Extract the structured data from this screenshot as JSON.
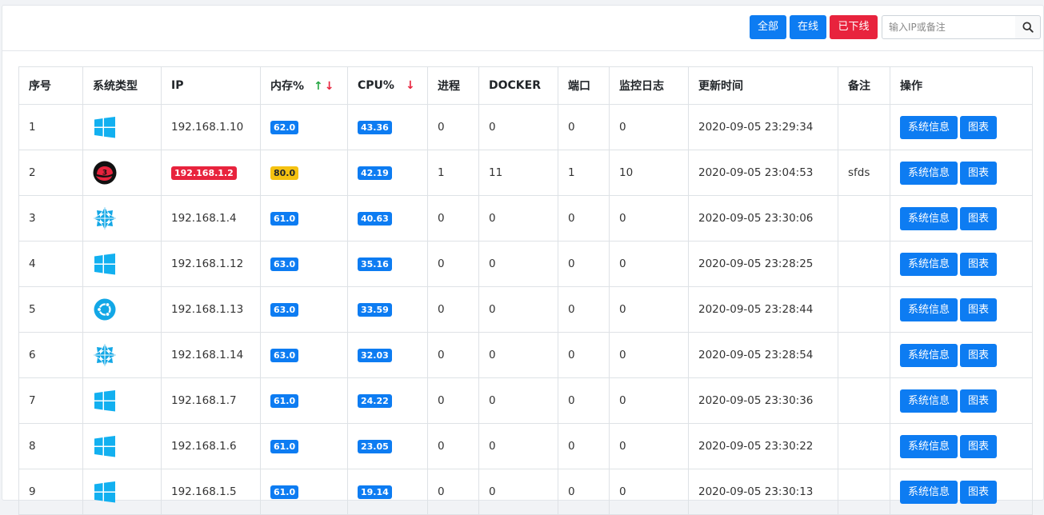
{
  "toolbar": {
    "all_label": "全部",
    "online_label": "在线",
    "offline_label": "已下线",
    "search_placeholder": "输入IP或备注"
  },
  "colors": {
    "primary": "#0d7cf2",
    "danger": "#e8233d",
    "warning": "#f5c211",
    "success": "#28a745"
  },
  "table": {
    "headers": {
      "index": "序号",
      "os": "系统类型",
      "ip": "IP",
      "mem": "内存%",
      "cpu": "CPU%",
      "proc": "进程",
      "docker": "DOCKER",
      "port": "端口",
      "log": "监控日志",
      "updated": "更新时间",
      "note": "备注",
      "action": "操作"
    },
    "sort": {
      "mem": "asc-desc",
      "cpu": "desc"
    },
    "action_labels": {
      "info": "系统信息",
      "chart": "图表"
    },
    "rows": [
      {
        "index": "1",
        "os": "windows-icon",
        "ip": "192.168.1.10",
        "ip_offline": false,
        "mem": "62.0",
        "mem_level": "normal",
        "cpu": "43.36",
        "proc": "0",
        "docker": "0",
        "port": "0",
        "log": "0",
        "updated": "2020-09-05 23:29:34",
        "note": ""
      },
      {
        "index": "2",
        "os": "redhat-icon",
        "ip": "192.168.1.2",
        "ip_offline": true,
        "mem": "80.0",
        "mem_level": "warning",
        "cpu": "42.19",
        "proc": "1",
        "docker": "11",
        "port": "1",
        "log": "10",
        "updated": "2020-09-05 23:04:53",
        "note": "sfds"
      },
      {
        "index": "3",
        "os": "centos-icon",
        "ip": "192.168.1.4",
        "ip_offline": false,
        "mem": "61.0",
        "mem_level": "normal",
        "cpu": "40.63",
        "proc": "0",
        "docker": "0",
        "port": "0",
        "log": "0",
        "updated": "2020-09-05 23:30:06",
        "note": ""
      },
      {
        "index": "4",
        "os": "windows-icon",
        "ip": "192.168.1.12",
        "ip_offline": false,
        "mem": "63.0",
        "mem_level": "normal",
        "cpu": "35.16",
        "proc": "0",
        "docker": "0",
        "port": "0",
        "log": "0",
        "updated": "2020-09-05 23:28:25",
        "note": ""
      },
      {
        "index": "5",
        "os": "ubuntu-icon",
        "ip": "192.168.1.13",
        "ip_offline": false,
        "mem": "63.0",
        "mem_level": "normal",
        "cpu": "33.59",
        "proc": "0",
        "docker": "0",
        "port": "0",
        "log": "0",
        "updated": "2020-09-05 23:28:44",
        "note": ""
      },
      {
        "index": "6",
        "os": "centos-icon",
        "ip": "192.168.1.14",
        "ip_offline": false,
        "mem": "63.0",
        "mem_level": "normal",
        "cpu": "32.03",
        "proc": "0",
        "docker": "0",
        "port": "0",
        "log": "0",
        "updated": "2020-09-05 23:28:54",
        "note": ""
      },
      {
        "index": "7",
        "os": "windows-icon",
        "ip": "192.168.1.7",
        "ip_offline": false,
        "mem": "61.0",
        "mem_level": "normal",
        "cpu": "24.22",
        "proc": "0",
        "docker": "0",
        "port": "0",
        "log": "0",
        "updated": "2020-09-05 23:30:36",
        "note": ""
      },
      {
        "index": "8",
        "os": "windows-icon",
        "ip": "192.168.1.6",
        "ip_offline": false,
        "mem": "61.0",
        "mem_level": "normal",
        "cpu": "23.05",
        "proc": "0",
        "docker": "0",
        "port": "0",
        "log": "0",
        "updated": "2020-09-05 23:30:22",
        "note": ""
      },
      {
        "index": "9",
        "os": "windows-icon",
        "ip": "192.168.1.5",
        "ip_offline": false,
        "mem": "61.0",
        "mem_level": "normal",
        "cpu": "19.14",
        "proc": "0",
        "docker": "0",
        "port": "0",
        "log": "0",
        "updated": "2020-09-05 23:30:13",
        "note": ""
      }
    ]
  }
}
